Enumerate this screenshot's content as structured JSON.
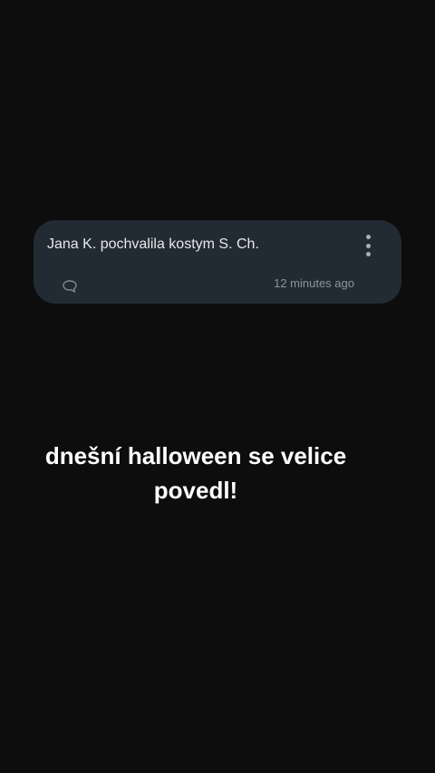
{
  "notification": {
    "text": "Jana K. pochvalila kostym S. Ch.",
    "time": "12 minutes ago",
    "icons": {
      "more": "more-vertical-icon",
      "comment": "comment-bubble-icon"
    }
  },
  "caption": {
    "line1": "dnešní halloween se velice",
    "line2": "povedl!"
  },
  "colors": {
    "background": "#0d0d0d",
    "card": "#222b33",
    "text_primary": "#e6e9ec",
    "text_secondary": "#8d959c",
    "caption": "#ffffff"
  }
}
